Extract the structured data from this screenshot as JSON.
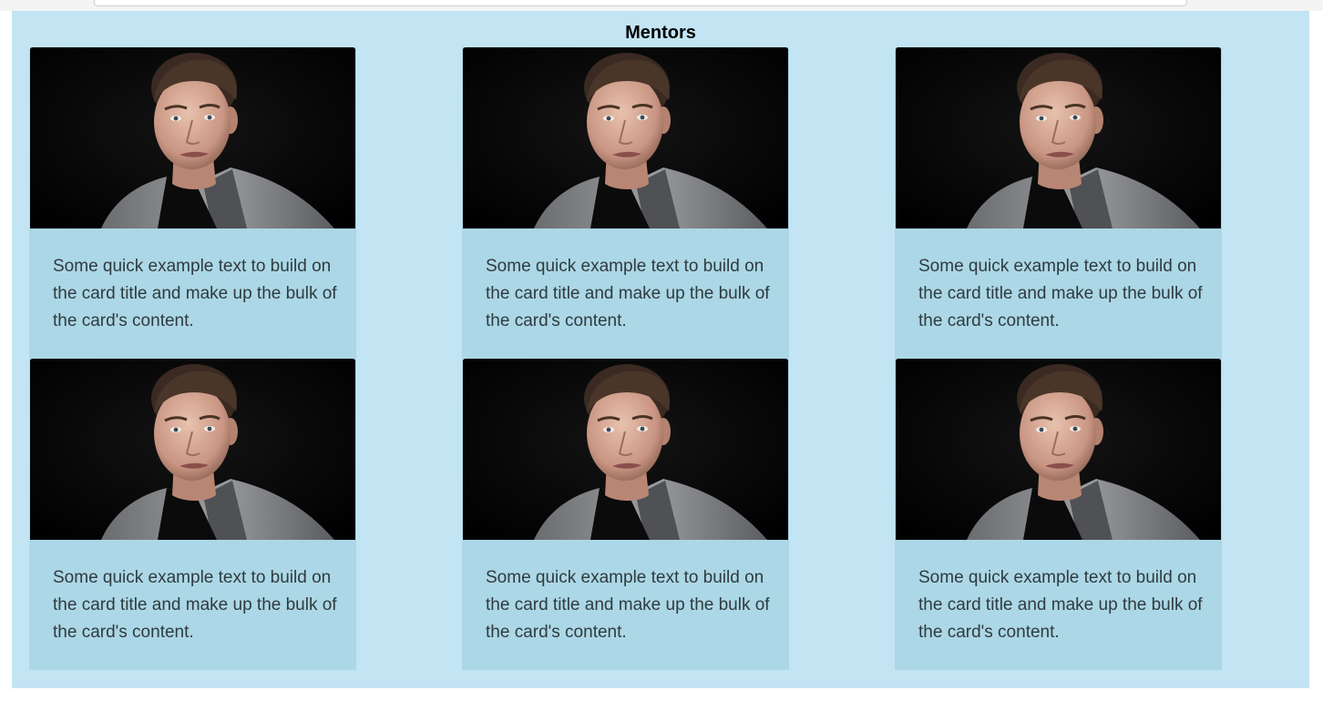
{
  "section": {
    "title": "Mentors"
  },
  "cards": [
    {
      "text": "Some quick example text to build on the card title and make up the bulk of the card's content."
    },
    {
      "text": "Some quick example text to build on the card title and make up the bulk of the card's content."
    },
    {
      "text": "Some quick example text to build on the card title and make up the bulk of the card's content."
    },
    {
      "text": "Some quick example text to build on the card title and make up the bulk of the card's content."
    },
    {
      "text": "Some quick example text to build on the card title and make up the bulk of the card's content."
    },
    {
      "text": "Some quick example text to build on the card title and make up the bulk of the card's content."
    }
  ],
  "colors": {
    "section_background": "#c2e4f3",
    "card_background": "#acd7e6",
    "photo_background": "#000000"
  }
}
